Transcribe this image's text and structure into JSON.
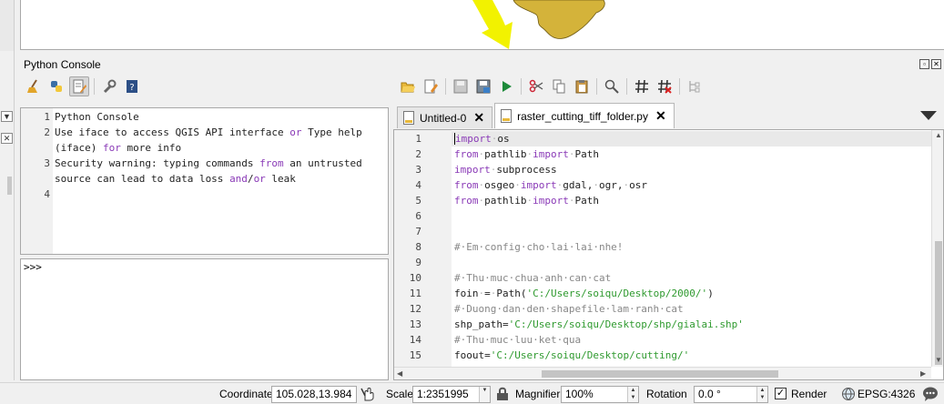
{
  "window": {
    "dock_title": "Python Console"
  },
  "icons": {
    "clear_console": "broom-icon",
    "run_command": "python-run-icon",
    "show_editor": "editor-icon",
    "options": "wrench-icon",
    "help": "help-book-icon",
    "open_script": "folder-open-icon",
    "open_in_external_editor": "edit-external-icon",
    "save": "save-icon",
    "save_as": "save-as-icon",
    "run_script": "play-icon",
    "cut": "cut-icon",
    "copy": "copy-icon",
    "paste": "paste-icon",
    "find": "magnifier-icon",
    "comment": "hash-icon",
    "uncomment": "uncomment-icon",
    "object_inspector": "tree-icon",
    "new_tab": "plus-icon",
    "tab_list_menu": "down-triangle-icon",
    "map_tips": "hand-pointer-icon",
    "lock_scale": "lock-icon",
    "messages": "speech-bubble-icon"
  },
  "colors": {
    "keyword": "#8a3ab7",
    "string": "#2f9a2f",
    "comment": "#888888",
    "map_polygon": "#d4b33a",
    "annotation_arrow": "#f2f200"
  },
  "console": {
    "output_lines": [
      {
        "num": "1",
        "parts": [
          {
            "t": "Python Console",
            "k": "plain"
          }
        ]
      },
      {
        "num": "2",
        "parts": [
          {
            "t": "Use iface to access QGIS API interface ",
            "k": "plain"
          },
          {
            "t": "or",
            "k": "kw"
          },
          {
            "t": " Type help",
            "k": "plain"
          }
        ]
      },
      {
        "num": "",
        "parts": [
          {
            "t": "(iface) ",
            "k": "plain"
          },
          {
            "t": "for",
            "k": "kw"
          },
          {
            "t": " more info",
            "k": "plain"
          }
        ]
      },
      {
        "num": "3",
        "parts": [
          {
            "t": "Security warning: typing commands ",
            "k": "plain"
          },
          {
            "t": "from",
            "k": "kw"
          },
          {
            "t": " an untrusted",
            "k": "plain"
          }
        ]
      },
      {
        "num": "",
        "parts": [
          {
            "t": " source can lead to data loss ",
            "k": "plain"
          },
          {
            "t": "and",
            "k": "kw"
          },
          {
            "t": "/",
            "k": "plain"
          },
          {
            "t": "or",
            "k": "kw"
          },
          {
            "t": " leak",
            "k": "plain"
          }
        ]
      },
      {
        "num": "4",
        "parts": []
      }
    ],
    "prompt": ">>>"
  },
  "editor": {
    "tabs": [
      {
        "label": "Untitled-0",
        "active": false
      },
      {
        "label": "raster_cutting_tiff_folder.py",
        "active": true
      }
    ],
    "lines": [
      {
        "num": "1",
        "parts": [
          {
            "t": "import",
            "k": "kw"
          },
          {
            "t": "·",
            "k": "ws"
          },
          {
            "t": "os",
            "k": "plain"
          }
        ]
      },
      {
        "num": "2",
        "parts": [
          {
            "t": "from",
            "k": "kw"
          },
          {
            "t": "·",
            "k": "ws"
          },
          {
            "t": "pathlib",
            "k": "plain"
          },
          {
            "t": "·",
            "k": "ws"
          },
          {
            "t": "import",
            "k": "kw"
          },
          {
            "t": "·",
            "k": "ws"
          },
          {
            "t": "Path",
            "k": "plain"
          }
        ]
      },
      {
        "num": "3",
        "parts": [
          {
            "t": "import",
            "k": "kw"
          },
          {
            "t": "·",
            "k": "ws"
          },
          {
            "t": "subprocess",
            "k": "plain"
          }
        ]
      },
      {
        "num": "4",
        "parts": [
          {
            "t": "from",
            "k": "kw"
          },
          {
            "t": "·",
            "k": "ws"
          },
          {
            "t": "osgeo",
            "k": "plain"
          },
          {
            "t": "·",
            "k": "ws"
          },
          {
            "t": "import",
            "k": "kw"
          },
          {
            "t": "·",
            "k": "ws"
          },
          {
            "t": "gdal,",
            "k": "plain"
          },
          {
            "t": "·",
            "k": "ws"
          },
          {
            "t": "ogr,",
            "k": "plain"
          },
          {
            "t": "·",
            "k": "ws"
          },
          {
            "t": "osr",
            "k": "plain"
          }
        ]
      },
      {
        "num": "5",
        "parts": [
          {
            "t": "from",
            "k": "kw"
          },
          {
            "t": "·",
            "k": "ws"
          },
          {
            "t": "pathlib",
            "k": "plain"
          },
          {
            "t": "·",
            "k": "ws"
          },
          {
            "t": "import",
            "k": "kw"
          },
          {
            "t": "·",
            "k": "ws"
          },
          {
            "t": "Path",
            "k": "plain"
          }
        ]
      },
      {
        "num": "6",
        "parts": []
      },
      {
        "num": "7",
        "parts": []
      },
      {
        "num": "8",
        "parts": [
          {
            "t": "#·Em·config·cho·lai·lai·nhe!",
            "k": "cm"
          }
        ]
      },
      {
        "num": "9",
        "parts": []
      },
      {
        "num": "10",
        "parts": [
          {
            "t": "#·Thu·muc·chua·anh·can·cat",
            "k": "cm"
          }
        ]
      },
      {
        "num": "11",
        "parts": [
          {
            "t": "foin",
            "k": "plain"
          },
          {
            "t": "·",
            "k": "ws"
          },
          {
            "t": "=",
            "k": "plain"
          },
          {
            "t": "·",
            "k": "ws"
          },
          {
            "t": "Path(",
            "k": "plain"
          },
          {
            "t": "'C:/Users/soiqu/Desktop/2000/'",
            "k": "st"
          },
          {
            "t": ")",
            "k": "plain"
          }
        ]
      },
      {
        "num": "12",
        "parts": [
          {
            "t": "#·Duong·dan·den·shapefile·lam·ranh·cat",
            "k": "cm"
          }
        ]
      },
      {
        "num": "13",
        "parts": [
          {
            "t": "shp_path=",
            "k": "plain"
          },
          {
            "t": "'C:/Users/soiqu/Desktop/shp/gialai.shp'",
            "k": "st"
          }
        ]
      },
      {
        "num": "14",
        "parts": [
          {
            "t": "#·Thu·muc·luu·ket·qua",
            "k": "cm"
          }
        ]
      },
      {
        "num": "15",
        "parts": [
          {
            "t": "foout=",
            "k": "plain"
          },
          {
            "t": "'C:/Users/soiqu/Desktop/cutting/'",
            "k": "st"
          }
        ]
      }
    ]
  },
  "statusbar": {
    "coordinate_label": "Coordinate",
    "coordinate_value": "105.028,13.984",
    "scale_label": "Scale",
    "scale_value": "1:2351995",
    "magnifier_label": "Magnifier",
    "magnifier_value": "100%",
    "rotation_label": "Rotation",
    "rotation_value": "0.0 °",
    "render_label": "Render",
    "render_checked": true,
    "crs_label": "EPSG:4326"
  }
}
